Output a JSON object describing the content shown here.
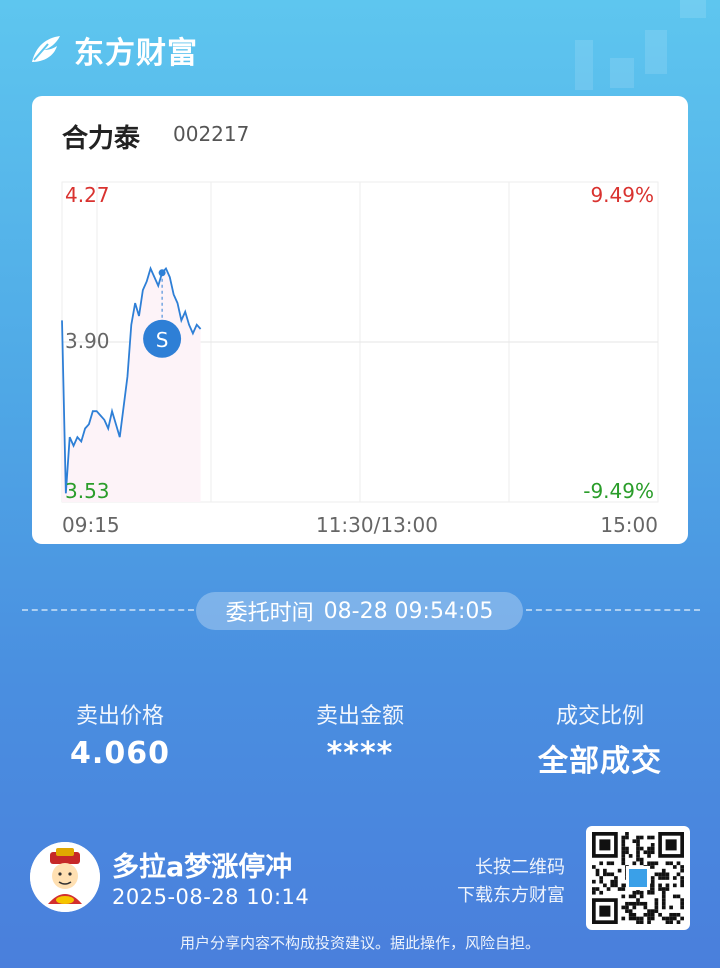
{
  "brand": {
    "name": "东方财富"
  },
  "stock": {
    "name": "合力泰",
    "code": "002217"
  },
  "chart_data": {
    "type": "line",
    "y_labels": {
      "high": "4.27",
      "mid": "3.90",
      "low": "3.53"
    },
    "pct_labels": {
      "high": "9.49%",
      "low": "-9.49%"
    },
    "x_labels": [
      "09:15",
      "11:30/13:00",
      "15:00"
    ],
    "ylim": [
      3.53,
      4.27
    ],
    "prev_close": 3.9,
    "series": [
      {
        "values": [
          3.95,
          3.55,
          3.68,
          3.66,
          3.68,
          3.67,
          3.7,
          3.71,
          3.74,
          3.74,
          3.73,
          3.72,
          3.7,
          3.74,
          3.71,
          3.68,
          3.75,
          3.82,
          3.94,
          3.99,
          3.96,
          4.02,
          4.04,
          4.07,
          4.05,
          4.03,
          4.06,
          4.07,
          4.05,
          4.01,
          3.99,
          3.95,
          3.97,
          3.94,
          3.92,
          3.94,
          3.93
        ]
      }
    ],
    "marker": {
      "label": "S",
      "price": 4.06
    },
    "colors": {
      "line": "#2e7fd6",
      "up": "#d9322f",
      "down": "#2a9d2a",
      "neutral": "#666666"
    }
  },
  "order": {
    "label": "委托时间",
    "time": "08-28 09:54:05"
  },
  "stats": [
    {
      "label": "卖出价格",
      "value": "4.060"
    },
    {
      "label": "卖出金额",
      "value": "****"
    },
    {
      "label": "成交比例",
      "value": "全部成交"
    }
  ],
  "user": {
    "name": "多拉a梦涨停冲",
    "timestamp": "2025-08-28 10:14"
  },
  "qr": {
    "line1": "长按二维码",
    "line2": "下载东方财富"
  },
  "disclaimer": "用户分享内容不构成投资建议。据此操作，风险自担。"
}
